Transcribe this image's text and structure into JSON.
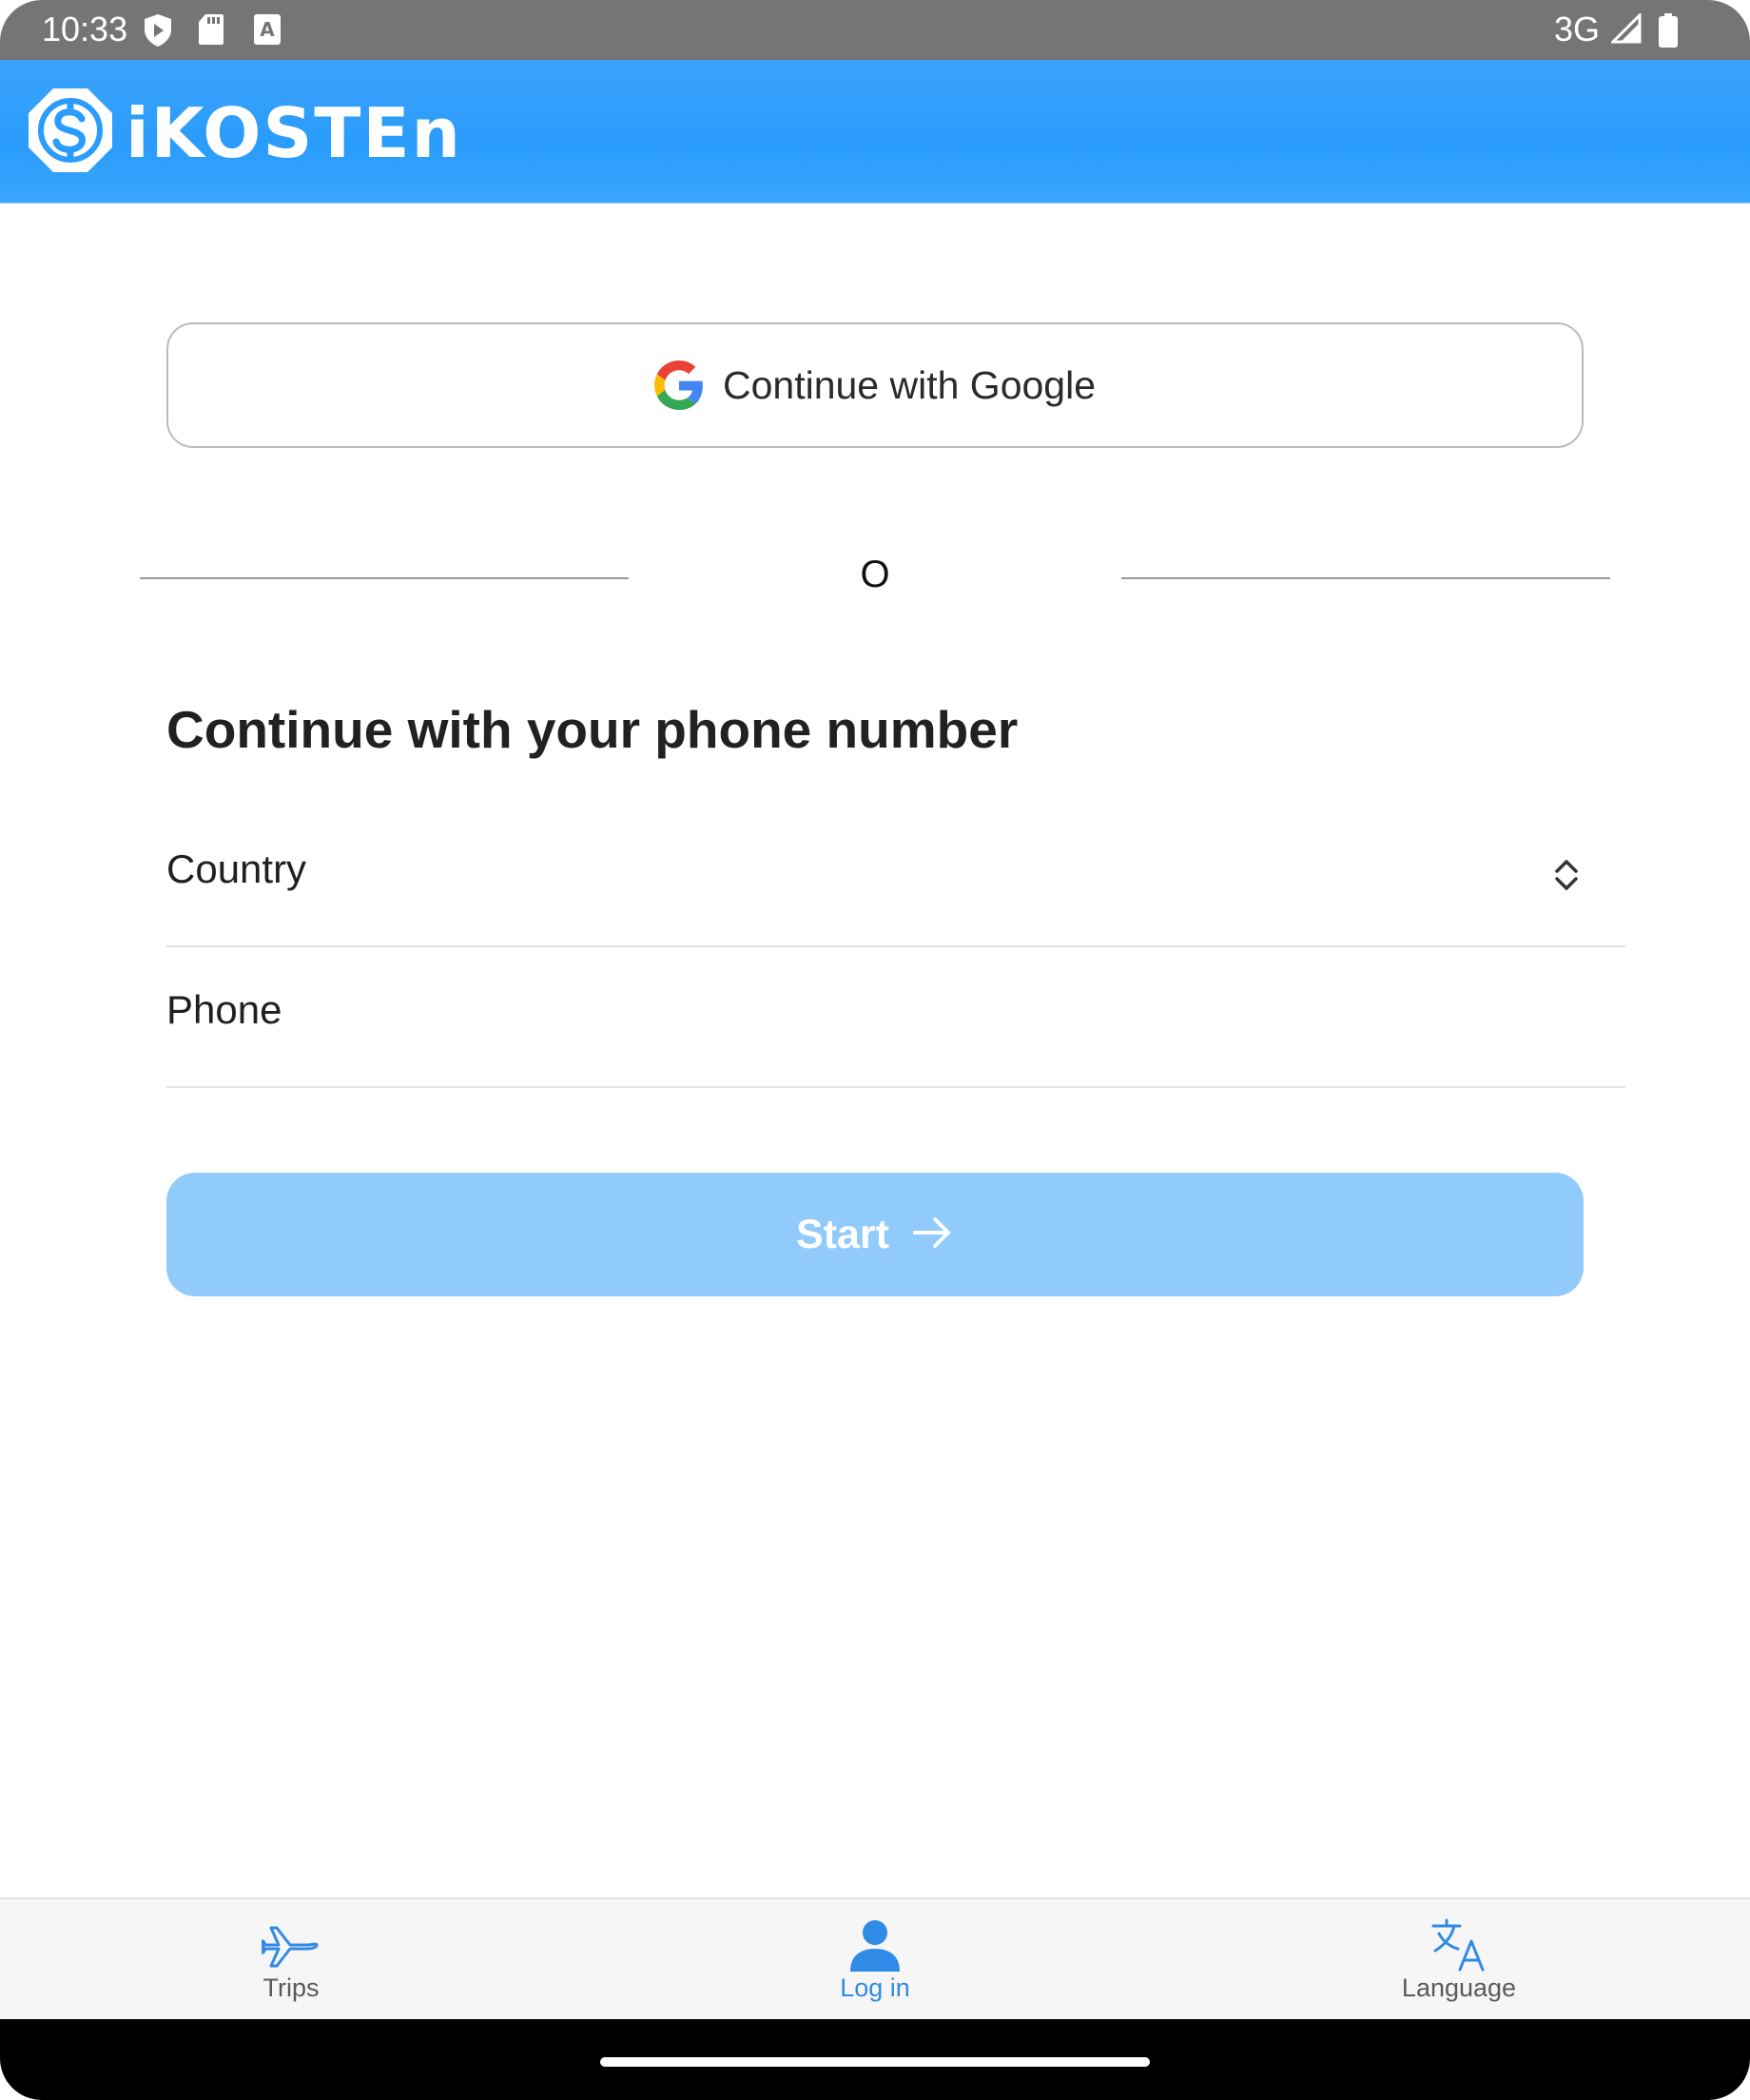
{
  "status_bar": {
    "time": "10:33",
    "network": "3G",
    "icons": [
      "shield-play-icon",
      "sd-card-icon",
      "keyboard-a-icon",
      "signal-icon",
      "battery-icon"
    ]
  },
  "app_bar": {
    "logo_text": "iKOSTEn",
    "logo_icon": "dollar-badge-icon",
    "background": "#2a9cfb"
  },
  "login": {
    "google_button_label": "Continue with Google",
    "divider_text": "O",
    "section_title": "Continue with your phone number",
    "country_label": "Country",
    "phone_label": "Phone",
    "start_button_label": "Start"
  },
  "bottom_nav": {
    "items": [
      {
        "label": "Trips",
        "icon": "airplane-icon",
        "active": false
      },
      {
        "label": "Log in",
        "icon": "person-icon",
        "active": true
      },
      {
        "label": "Language",
        "icon": "translate-icon",
        "active": false
      }
    ],
    "active_color": "#2f8be6",
    "inactive_color": "#5a5a5a"
  },
  "colors": {
    "primary": "#2a9cfb",
    "start_button_disabled": "#90cbfc"
  }
}
